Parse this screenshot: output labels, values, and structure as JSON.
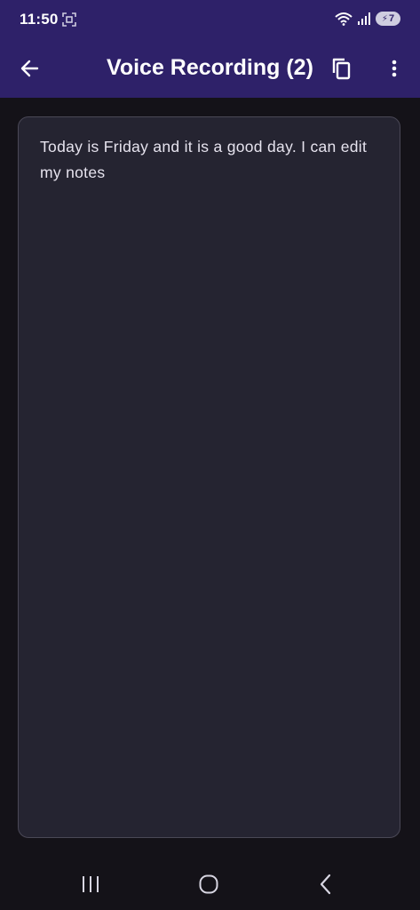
{
  "status_bar": {
    "time": "11:50",
    "battery_level": "7",
    "icons": [
      "screen-record-icon",
      "wifi-icon",
      "signal-icon",
      "battery-charging-icon"
    ]
  },
  "app_bar": {
    "title": "Voice Recording (2)",
    "icons": [
      "back-arrow-icon",
      "copy-icon",
      "more-vert-icon"
    ]
  },
  "note": {
    "text": "Today is Friday and it is a good day. I can edit my notes"
  },
  "nav_bar": {
    "icons": [
      "recent-apps-icon",
      "home-icon",
      "back-icon"
    ]
  },
  "colors": {
    "top_bar": "#2e2169",
    "background": "#141218",
    "card": "#252431",
    "card_border": "#4a4856",
    "text": "#e6e3ee"
  }
}
